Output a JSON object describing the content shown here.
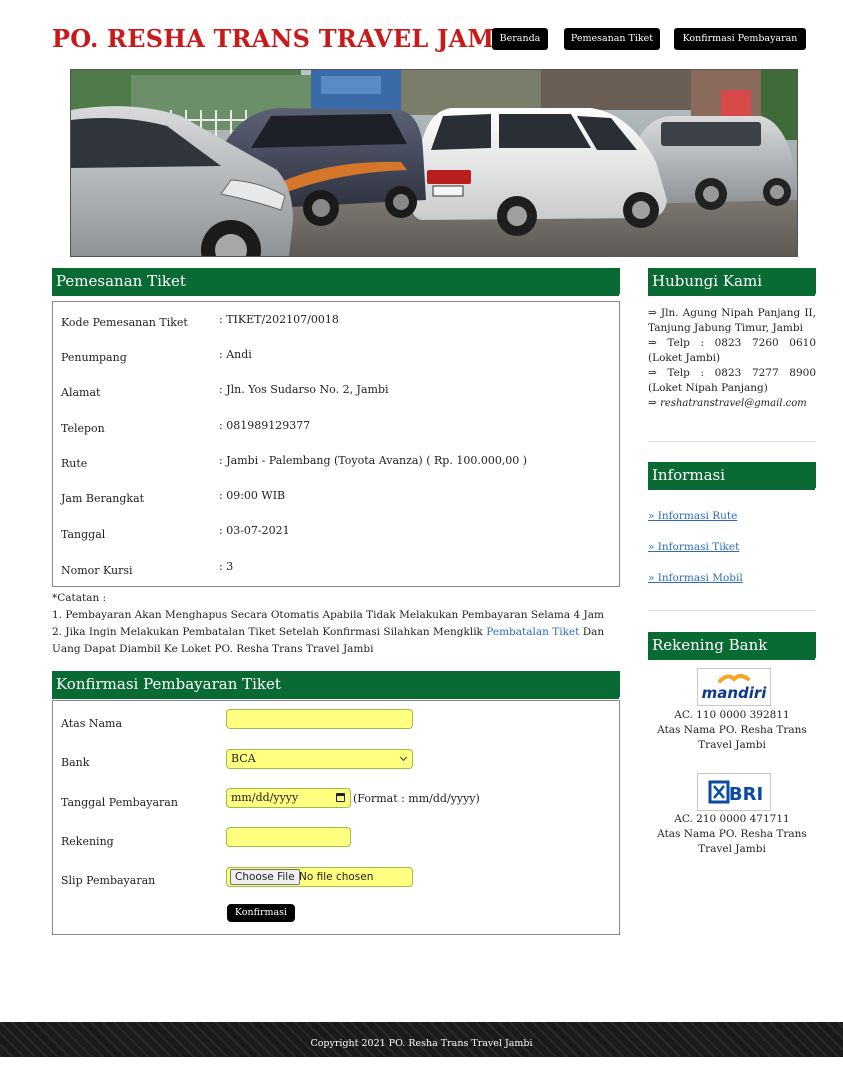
{
  "site": {
    "title": "PO. RESHA TRANS TRAVEL JAMBI"
  },
  "nav": [
    {
      "label": "Beranda"
    },
    {
      "label": "Pemesanan Tiket"
    },
    {
      "label": "Konfirmasi Pembayaran"
    }
  ],
  "booking": {
    "heading": "Pemesanan Tiket",
    "rows": [
      {
        "label": "Kode Pemesanan Tiket",
        "value": ": TIKET/202107/0018"
      },
      {
        "label": "Penumpang",
        "value": ": Andi"
      },
      {
        "label": "Alamat",
        "value": ": Jln. Yos Sudarso No. 2, Jambi"
      },
      {
        "label": "Telepon",
        "value": ": 081989129377"
      },
      {
        "label": "Rute",
        "value": ": Jambi - Palembang (Toyota Avanza) ( Rp. 100.000,00 )"
      },
      {
        "label": "Jam Berangkat",
        "value": ": 09:00 WIB"
      },
      {
        "label": "Tanggal",
        "value": ": 03-07-2021"
      },
      {
        "label": "Nomor Kursi",
        "value": ": 3"
      }
    ]
  },
  "notes": {
    "title": "*Catatan :",
    "line1": "1. Pembayaran Akan Menghapus Secara Otomatis Apabila Tidak Melakukan Pembayaran Selama 4 Jam",
    "line2_before": "2. Jika Ingin Melakukan Pembatalan Tiket Setelah Konfirmasi Silahkan Mengklik ",
    "line2_link": "Pembatalan Tiket",
    "line2_after": " Dan Uang Dapat Diambil Ke Loket PO. Resha Trans Travel Jambi"
  },
  "confirm": {
    "heading": "Konfirmasi Pembayaran Tiket",
    "atas_nama_label": "Atas Nama",
    "atas_nama_value": "",
    "bank_label": "Bank",
    "bank_selected": "BCA",
    "tanggal_label": "Tanggal Pembayaran",
    "tanggal_placeholder": "mm/dd/yyyy",
    "tanggal_format_hint": "(Format : mm/dd/yyyy)",
    "rekening_label": "Rekening",
    "rekening_value": "",
    "slip_label": "Slip Pembayaran",
    "choose_file_label": "Choose File",
    "no_file_text": "No file chosen",
    "submit_label": "Konfirmasi"
  },
  "sidebar": {
    "contact_heading": "Hubungi Kami",
    "contact_lines": [
      "⇒ Jln. Agung Nipah Panjang II, Tanjung Jabung Timur, Jambi",
      "⇒ Telp : 0823 7260 0610 (Loket Jambi)",
      "⇒ Telp : 0823 7277 8900 (Loket Nipah Panjang)"
    ],
    "email": "reshatranstravel@gmail.com",
    "email_prefix": "⇒ ",
    "info_heading": "Informasi",
    "info_links": [
      "» Informasi Rute",
      "» Informasi Tiket",
      "» Informasi Mobil"
    ],
    "bank_heading": "Rekening Bank",
    "banks": [
      {
        "logo": "mandiri",
        "account": "AC. 110 0000 392811",
        "holder": "Atas Nama PO. Resha Trans Travel Jambi",
        "color": "#0a3a8a",
        "accent": "#f5a623"
      },
      {
        "logo": "BRI",
        "account": "AC. 210 0000 471711",
        "holder": "Atas Nama PO. Resha Trans Travel Jambi",
        "color": "#0a4aa0"
      }
    ]
  },
  "footer": {
    "copyright": "Copyright 2021 PO. Resha Trans Travel Jambi"
  },
  "colors": {
    "title_red": "#c81a1a",
    "section_green": "#0a6a33",
    "input_yellow": "#ffff80",
    "link_blue": "#2d6bb5"
  }
}
